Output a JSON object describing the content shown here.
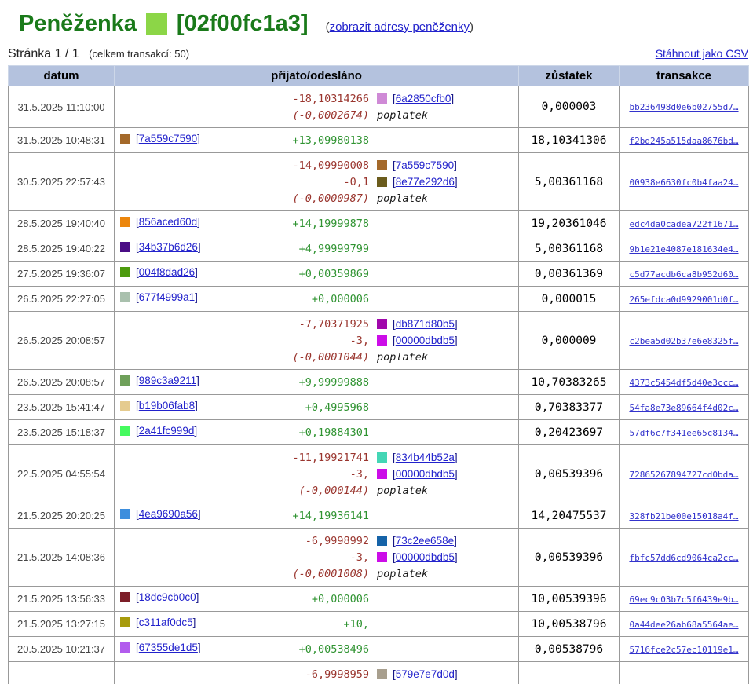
{
  "header": {
    "title": "Peněženka",
    "wallet_id": "[02f00fc1a3]",
    "wallet_color": "#8cd647",
    "addresses_link_prefix": "(",
    "addresses_link": "zobrazit adresy peněženky",
    "addresses_link_suffix": ")"
  },
  "pagination": {
    "page_text": "Stránka 1 / 1",
    "total_text": "(celkem transakcí: 50)",
    "csv_link": "Stáhnout jako CSV"
  },
  "colors": {
    "title_green": "#1a7a1a",
    "link_blue": "#2222cc",
    "header_bg": "#b4c2de",
    "positive_amount": "#2f9331",
    "negative_amount": "#9a352e"
  },
  "table": {
    "columns": [
      "datum",
      "přijato/odesláno",
      "zůstatek",
      "transakce"
    ],
    "fee_label": "poplatek",
    "rows": [
      {
        "date": "31.5.2025 11:10:00",
        "lines": [
          {
            "type": "out",
            "amount": "-18,10314266",
            "address": "6a2850cfb0",
            "color": "#cf8ad6"
          },
          {
            "type": "fee",
            "amount": "(-0,0002674)"
          }
        ],
        "balance": "0,000003",
        "tx": "bb236498d0e6b02755d7…"
      },
      {
        "date": "31.5.2025 10:48:31",
        "lines": [
          {
            "type": "in",
            "amount": "+13,09980138",
            "address": "7a559c7590",
            "color": "#a4692a"
          }
        ],
        "balance": "18,10341306",
        "tx": "f2bd245a515daa8676bd…"
      },
      {
        "date": "30.5.2025 22:57:43",
        "lines": [
          {
            "type": "out",
            "amount": "-14,09990008",
            "address": "7a559c7590",
            "color": "#a4692a"
          },
          {
            "type": "out",
            "amount": "-0,1",
            "address": "8e77e292d6",
            "color": "#6b5c1d"
          },
          {
            "type": "fee",
            "amount": "(-0,0000987)"
          }
        ],
        "balance": "5,00361168",
        "tx": "00938e6630fc0b4faa24…"
      },
      {
        "date": "28.5.2025 19:40:40",
        "lines": [
          {
            "type": "in",
            "amount": "+14,19999878",
            "address": "856aced60d",
            "color": "#ec860d"
          }
        ],
        "balance": "19,20361046",
        "tx": "edc4da0cadea722f1671…"
      },
      {
        "date": "28.5.2025 19:40:22",
        "lines": [
          {
            "type": "in",
            "amount": "+4,99999799",
            "address": "34b37b6d26",
            "color": "#4a0d85"
          }
        ],
        "balance": "5,00361168",
        "tx": "9b1e21e4087e181634e4…"
      },
      {
        "date": "27.5.2025 19:36:07",
        "lines": [
          {
            "type": "in",
            "amount": "+0,00359869",
            "address": "004f8dad26",
            "color": "#4d9b0e"
          }
        ],
        "balance": "0,00361369",
        "tx": "c5d77acdb6ca8b952d60…"
      },
      {
        "date": "26.5.2025 22:27:05",
        "lines": [
          {
            "type": "in",
            "amount": "+0,000006",
            "address": "677f4999a1",
            "color": "#a9c0ad"
          }
        ],
        "balance": "0,000015",
        "tx": "265efdca0d9929001d0f…"
      },
      {
        "date": "26.5.2025 20:08:57",
        "lines": [
          {
            "type": "out",
            "amount": "-7,70371925",
            "address": "db871d80b5",
            "color": "#a008ab"
          },
          {
            "type": "out",
            "amount": "-3,",
            "address": "00000dbdb5",
            "color": "#cc0de8"
          },
          {
            "type": "fee",
            "amount": "(-0,0001044)"
          }
        ],
        "balance": "0,000009",
        "tx": "c2bea5d02b37e6e8325f…"
      },
      {
        "date": "26.5.2025 20:08:57",
        "lines": [
          {
            "type": "in",
            "amount": "+9,99999888",
            "address": "989c3a9211",
            "color": "#6fa05a"
          }
        ],
        "balance": "10,70383265",
        "tx": "4373c5454df5d40e3ccc…"
      },
      {
        "date": "23.5.2025 15:41:47",
        "lines": [
          {
            "type": "in",
            "amount": "+0,4995968",
            "address": "b19b06fab8",
            "color": "#e5cb8f"
          }
        ],
        "balance": "0,70383377",
        "tx": "54fa8e73e89664f4d02c…"
      },
      {
        "date": "23.5.2025 15:18:37",
        "lines": [
          {
            "type": "in",
            "amount": "+0,19884301",
            "address": "2a41fc999d",
            "color": "#45fa5f"
          }
        ],
        "balance": "0,20423697",
        "tx": "57df6c7f341ee65c8134…"
      },
      {
        "date": "22.5.2025 04:55:54",
        "lines": [
          {
            "type": "out",
            "amount": "-11,19921741",
            "address": "834b44b52a",
            "color": "#44d6b5"
          },
          {
            "type": "out",
            "amount": "-3,",
            "address": "00000dbdb5",
            "color": "#cc0de8"
          },
          {
            "type": "fee",
            "amount": "(-0,000144)"
          }
        ],
        "balance": "0,00539396",
        "tx": "72865267894727cd0bda…"
      },
      {
        "date": "21.5.2025 20:20:25",
        "lines": [
          {
            "type": "in",
            "amount": "+14,19936141",
            "address": "4ea9690a56",
            "color": "#3d8edd"
          }
        ],
        "balance": "14,20475537",
        "tx": "328fb21be00e15018a4f…"
      },
      {
        "date": "21.5.2025 14:08:36",
        "lines": [
          {
            "type": "out",
            "amount": "-6,9998992",
            "address": "73c2ee658e",
            "color": "#1663a8"
          },
          {
            "type": "out",
            "amount": "-3,",
            "address": "00000dbdb5",
            "color": "#cc0de8"
          },
          {
            "type": "fee",
            "amount": "(-0,0001008)"
          }
        ],
        "balance": "0,00539396",
        "tx": "fbfc57dd6cd9064ca2cc…"
      },
      {
        "date": "21.5.2025 13:56:33",
        "lines": [
          {
            "type": "in",
            "amount": "+0,000006",
            "address": "18dc9cb0c0",
            "color": "#7c1e28"
          }
        ],
        "balance": "10,00539396",
        "tx": "69ec9c03b7c5f6439e9b…"
      },
      {
        "date": "21.5.2025 13:27:15",
        "lines": [
          {
            "type": "in",
            "amount": "+10,",
            "address": "c311af0dc5",
            "color": "#a79b0d"
          }
        ],
        "balance": "10,00538796",
        "tx": "0a44dee26ab68a5564ae…"
      },
      {
        "date": "20.5.2025 10:21:37",
        "lines": [
          {
            "type": "in",
            "amount": "+0,00538496",
            "address": "67355de1d5",
            "color": "#b25ced"
          }
        ],
        "balance": "0,00538796",
        "tx": "5716fce2c57ec10119e1…"
      },
      {
        "date": "",
        "lines": [
          {
            "type": "out",
            "amount": "-6,9998959",
            "address": "579e7e7d0d",
            "color": "#a89f8e"
          }
        ],
        "balance": "",
        "tx": ""
      }
    ]
  }
}
